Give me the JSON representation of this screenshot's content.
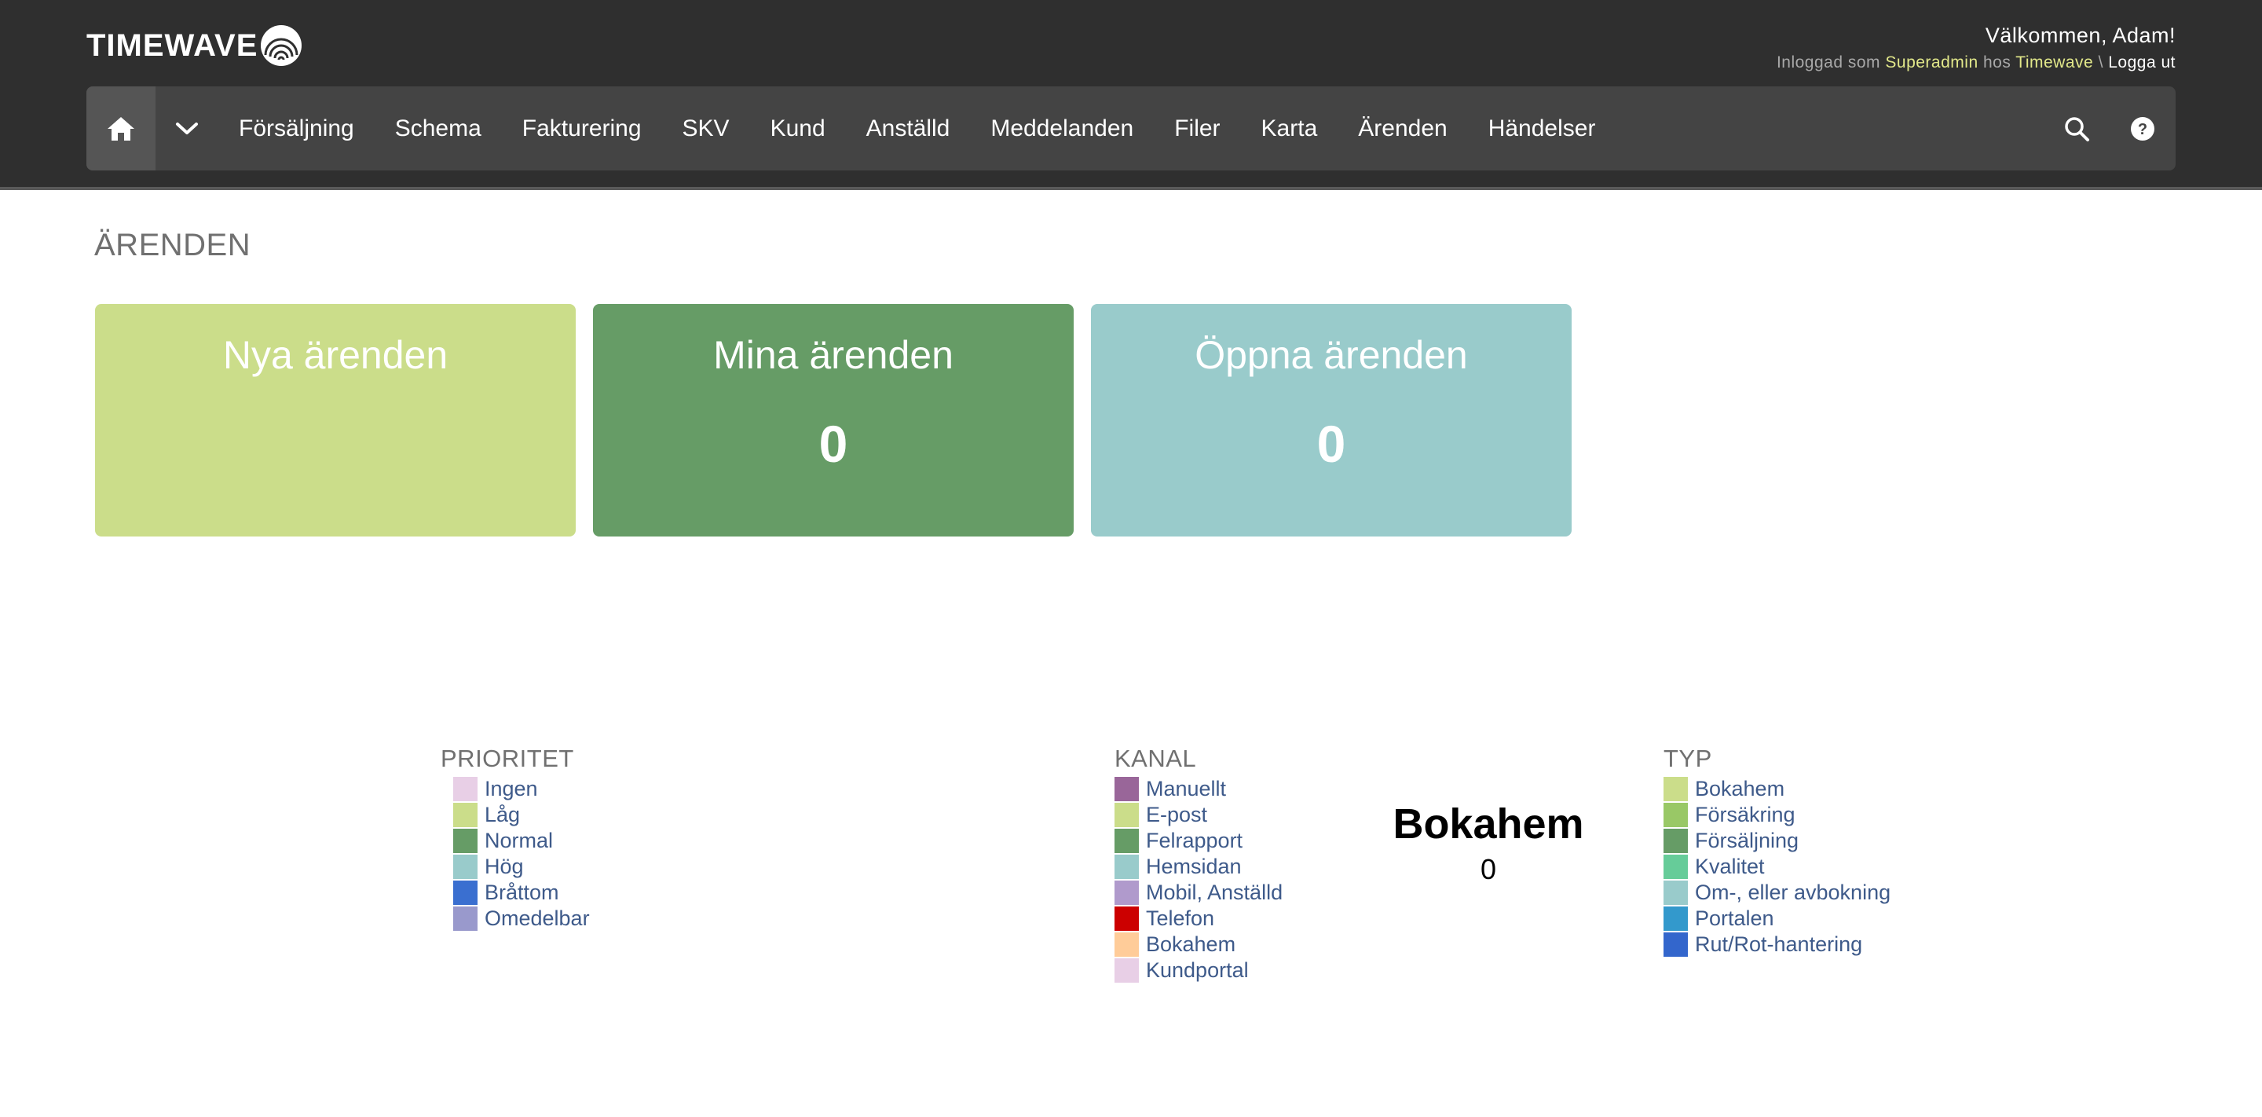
{
  "header": {
    "logo_text": "TIMEWAVE",
    "welcome": "Välkommen, Adam!",
    "login_prefix": "Inloggad som",
    "role": "Superadmin",
    "login_mid": "hos",
    "company": "Timewave",
    "separator": "\\",
    "logout_label": "Logga ut"
  },
  "nav": {
    "items": [
      {
        "label": "Försäljning"
      },
      {
        "label": "Schema"
      },
      {
        "label": "Fakturering"
      },
      {
        "label": "SKV"
      },
      {
        "label": "Kund"
      },
      {
        "label": "Anställd"
      },
      {
        "label": "Meddelanden"
      },
      {
        "label": "Filer"
      },
      {
        "label": "Karta"
      },
      {
        "label": "Ärenden"
      },
      {
        "label": "Händelser"
      }
    ],
    "icons": {
      "home": "home-icon",
      "dropdown": "chevron-down-icon",
      "search": "search-icon",
      "help": "help-icon"
    }
  },
  "page": {
    "title": "ÄRENDEN"
  },
  "tiles": [
    {
      "title": "Nya ärenden",
      "count": "",
      "color": "#cbdd8a"
    },
    {
      "title": "Mina ärenden",
      "count": "0",
      "color": "#669c66"
    },
    {
      "title": "Öppna ärenden",
      "count": "0",
      "color": "#99cbcb"
    }
  ],
  "legends": {
    "prioritet": {
      "title": "PRIORITET",
      "items": [
        {
          "label": "Ingen",
          "color": "#e8cfe6"
        },
        {
          "label": "Låg",
          "color": "#cbdd8a"
        },
        {
          "label": "Normal",
          "color": "#669c66"
        },
        {
          "label": "Hög",
          "color": "#99cbcb"
        },
        {
          "label": "Bråttom",
          "color": "#3a6fd0"
        },
        {
          "label": "Omedelbar",
          "color": "#9999cc"
        }
      ]
    },
    "kanal": {
      "title": "KANAL",
      "items": [
        {
          "label": "Manuellt",
          "color": "#996699"
        },
        {
          "label": "E-post",
          "color": "#cbdd8a"
        },
        {
          "label": "Felrapport",
          "color": "#669c66"
        },
        {
          "label": "Hemsidan",
          "color": "#99cbcb"
        },
        {
          "label": "Mobil, Anställd",
          "color": "#b09acc"
        },
        {
          "label": "Telefon",
          "color": "#cc0000"
        },
        {
          "label": "Bokahem",
          "color": "#ffcc99"
        },
        {
          "label": "Kundportal",
          "color": "#e8cfe6"
        }
      ]
    },
    "typ": {
      "title": "TYP",
      "items": [
        {
          "label": "Bokahem",
          "color": "#cbdd8a"
        },
        {
          "label": "Försäkring",
          "color": "#99c866"
        },
        {
          "label": "Försäljning",
          "color": "#669c66"
        },
        {
          "label": "Kvalitet",
          "color": "#66cc99"
        },
        {
          "label": "Om-, eller avbokning",
          "color": "#99cbcb"
        },
        {
          "label": "Portalen",
          "color": "#3399cc"
        },
        {
          "label": "Rut/Rot-hantering",
          "color": "#3366cc"
        }
      ]
    }
  },
  "bokahem_summary": {
    "title": "Bokahem",
    "count": "0"
  }
}
